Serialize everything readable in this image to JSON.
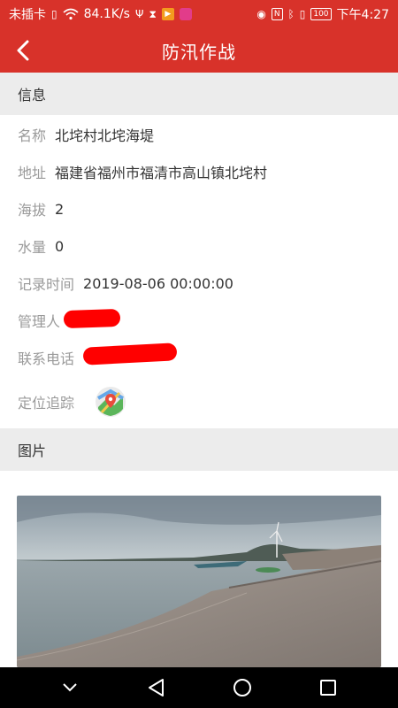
{
  "status_bar": {
    "carrier": "未插卡",
    "speed": "84.1K/s",
    "battery": "100",
    "time": "下午4:27"
  },
  "app_bar": {
    "title": "防汛作战"
  },
  "info_section": {
    "header": "信息",
    "name_label": "名称",
    "name_value": "北垞村北垞海堤",
    "address_label": "地址",
    "address_value": "福建省福州市福清市高山镇北垞村",
    "altitude_label": "海拔",
    "altitude_value": "2",
    "water_label": "水量",
    "water_value": "0",
    "record_time_label": "记录时间",
    "record_time_value": "2019-08-06 00:00:00",
    "manager_label": "管理人",
    "phone_label": "联系电话",
    "location_label": "定位追踪"
  },
  "photo_section": {
    "header": "图片"
  },
  "colors": {
    "accent": "#d8322a",
    "section_bg": "#ececec",
    "label": "#9a9a9a",
    "redaction": "#ff0000"
  }
}
